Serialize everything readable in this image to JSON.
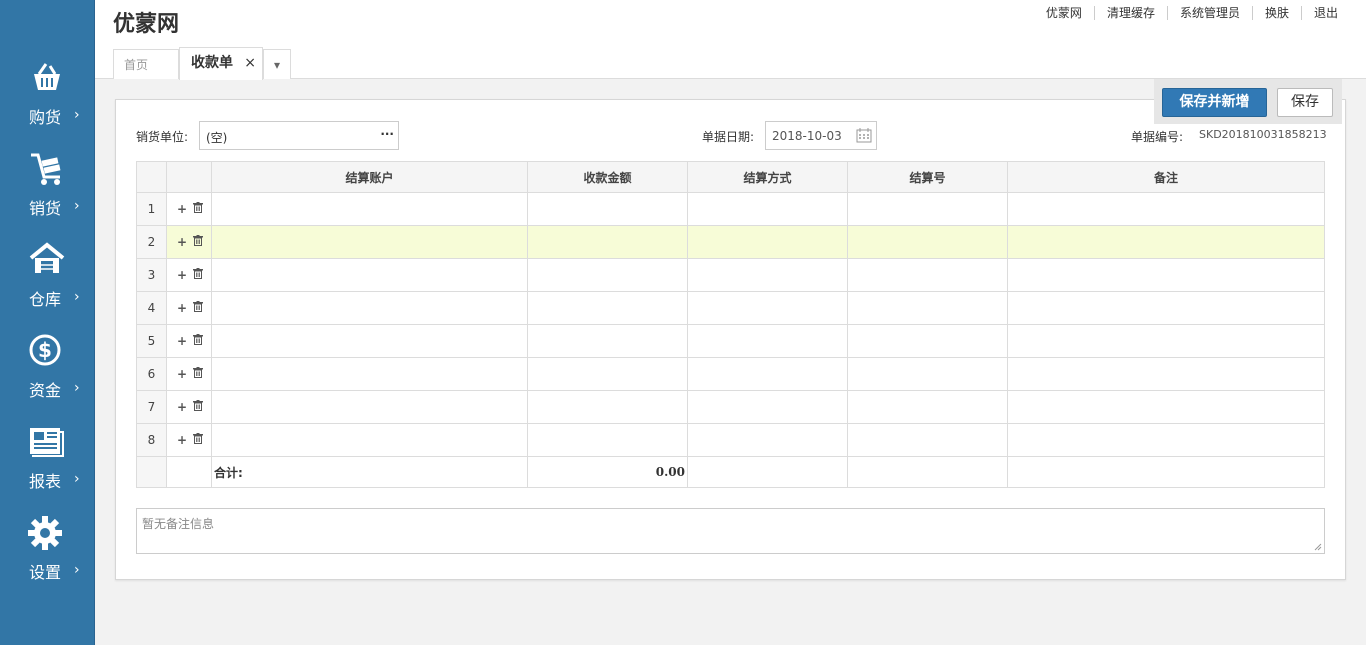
{
  "sidebar": {
    "items": [
      {
        "label": "购货",
        "icon": "basket-icon"
      },
      {
        "label": "销货",
        "icon": "cart-icon"
      },
      {
        "label": "仓库",
        "icon": "warehouse-icon"
      },
      {
        "label": "资金",
        "icon": "dollar-icon"
      },
      {
        "label": "报表",
        "icon": "newspaper-icon"
      },
      {
        "label": "设置",
        "icon": "gear-icon"
      }
    ],
    "arrow": "›",
    "color": "#3276a6"
  },
  "header": {
    "brand": "优蒙网",
    "topnav": [
      "优蒙网",
      "清理缓存",
      "系统管理员",
      "换肤",
      "退出"
    ],
    "tabs": {
      "home": "首页",
      "active": "收款单",
      "close": "×",
      "more": "▾"
    }
  },
  "toolbar": {
    "save_new_label": "保存并新增",
    "save_label": "保存"
  },
  "form": {
    "customer_label": "销货单位:",
    "customer_value": "(空)",
    "customer_more": "···",
    "date_label": "单据日期:",
    "date_value": "2018-10-03",
    "docno_label": "单据编号:",
    "docno_value": "SKD201810031858213"
  },
  "table": {
    "columns": [
      "结算账户",
      "收款金额",
      "结算方式",
      "结算号",
      "备注"
    ],
    "rows": [
      {
        "num": "1"
      },
      {
        "num": "2"
      },
      {
        "num": "3"
      },
      {
        "num": "4"
      },
      {
        "num": "5"
      },
      {
        "num": "6"
      },
      {
        "num": "7"
      },
      {
        "num": "8"
      }
    ],
    "add_glyph": "+",
    "total_label": "合计:",
    "total_amount": "0.00"
  },
  "remark": {
    "placeholder": "暂无备注信息"
  }
}
